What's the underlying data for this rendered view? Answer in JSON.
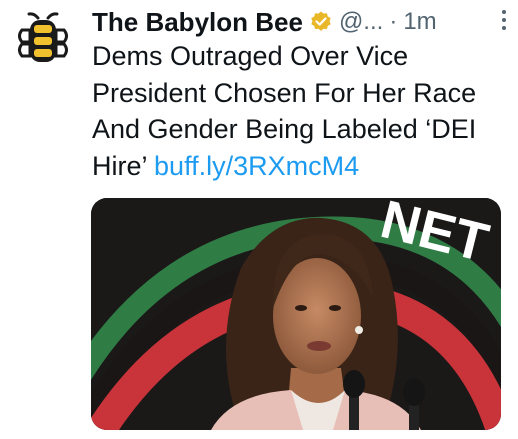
{
  "tweet": {
    "author_name": "The Babylon Bee",
    "handle": "@...",
    "separator": "·",
    "timestamp": "1m",
    "verified_color": "#e8b829",
    "text_lines": [
      "Dems Outraged Over Vice",
      "President Chosen For Her Race",
      "And Gender Being Labeled ‘DEI",
      "Hire’"
    ],
    "link": "buff.ly/3RXmcM4",
    "link_color": "#1d9bf0"
  },
  "icons": {
    "avatar": "babylon-bee-logo",
    "verified": "verified-badge-icon",
    "more": "more-options-icon"
  },
  "media": {
    "background_letters": "NET"
  }
}
